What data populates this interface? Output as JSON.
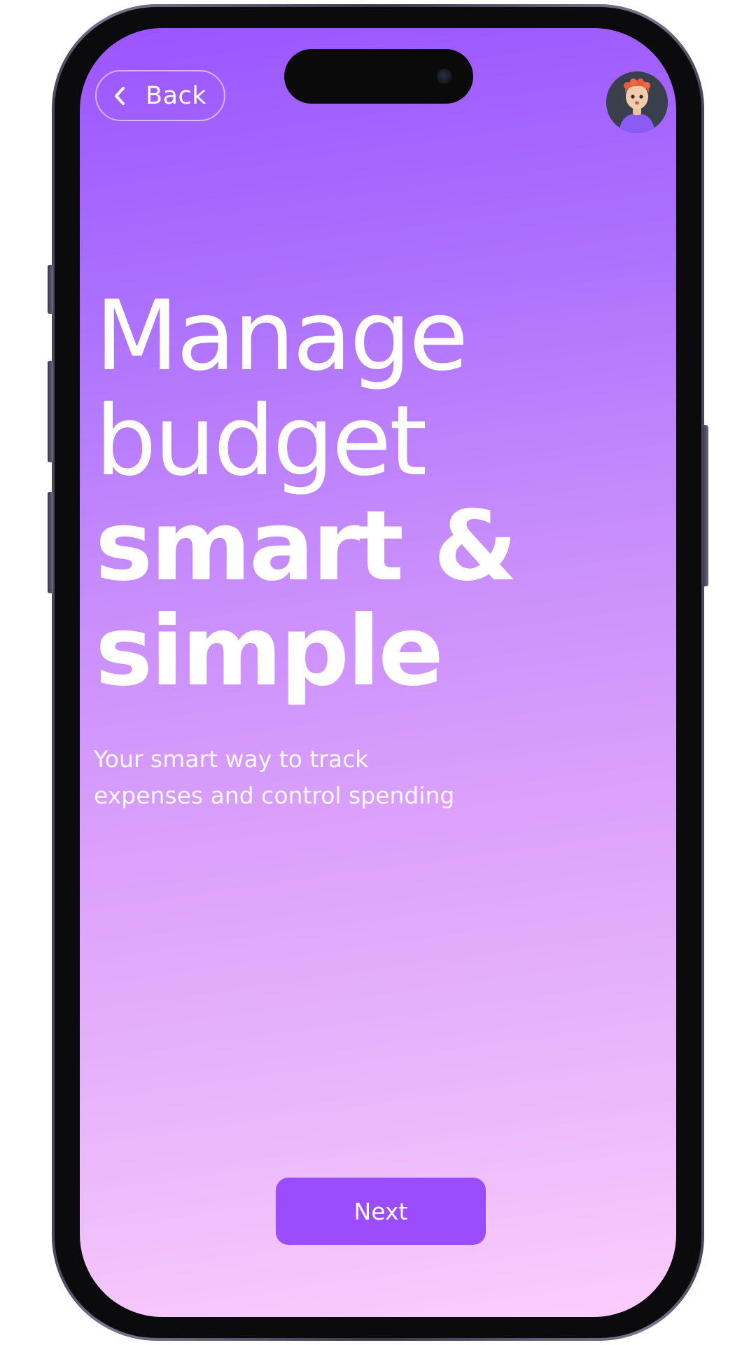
{
  "header": {
    "back_label": "Back",
    "back_icon": "chevron-left-icon",
    "avatar_icon": "user-avatar"
  },
  "onboarding": {
    "headline_lines": [
      "Manage",
      "budget",
      "smart &",
      "simple"
    ],
    "subtitle_lines": [
      "Your smart way to track",
      "expenses and control spending"
    ]
  },
  "footer": {
    "next_label": "Next"
  },
  "colors": {
    "gradient_top": "#9b55fe",
    "gradient_bottom": "#fbcdfd",
    "button": "#9b4dfe",
    "text": "#ffffff"
  }
}
